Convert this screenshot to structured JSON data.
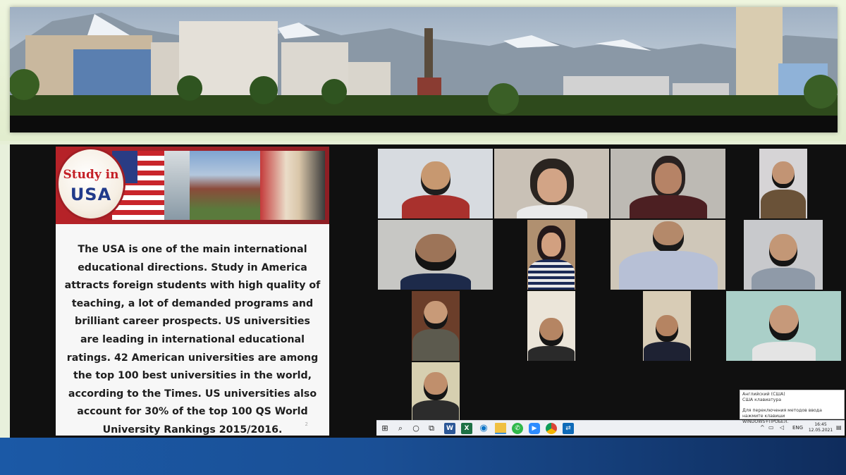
{
  "slide": {
    "badge_line1": "Study in",
    "badge_line2": "USA",
    "body_text": "The USA is one of the main international educational directions. Study in America attracts foreign students with high quality of teaching, a lot of demanded programs and brilliant career prospects. US universities are leading in international educational ratings. 42 American universities are among the top 100 best universities in the world, according to the Times. US universities also account for 30% of the top 100 QS World University Rankings 2015/2016.",
    "page_number": "2"
  },
  "taskbar": {
    "start_icon": "windows-start-icon",
    "search_icon": "search-icon",
    "cortana_icon": "cortana-circle-icon",
    "task_view_icon": "task-view-icon",
    "pinned_apps": [
      "word-icon",
      "excel-icon",
      "edge-icon",
      "file-explorer-icon",
      "whatsapp-icon",
      "zoom-icon",
      "chrome-icon",
      "teamviewer-icon"
    ],
    "language": "ENG",
    "time": "16:45",
    "date": "12.05.2021"
  },
  "ime_tooltip": {
    "line1": "Английский (США)",
    "line2": "США клавиатура",
    "line3": "Для переключения методов ввода нажмите клавиши",
    "line4": "WINDOWS+ПРОБЕЛ."
  },
  "colors": {
    "slide_header_red": "#b72228",
    "usa_blue": "#213a8a",
    "bottom_band": "#1b59a6",
    "banner_frame": "#e6efd6"
  }
}
